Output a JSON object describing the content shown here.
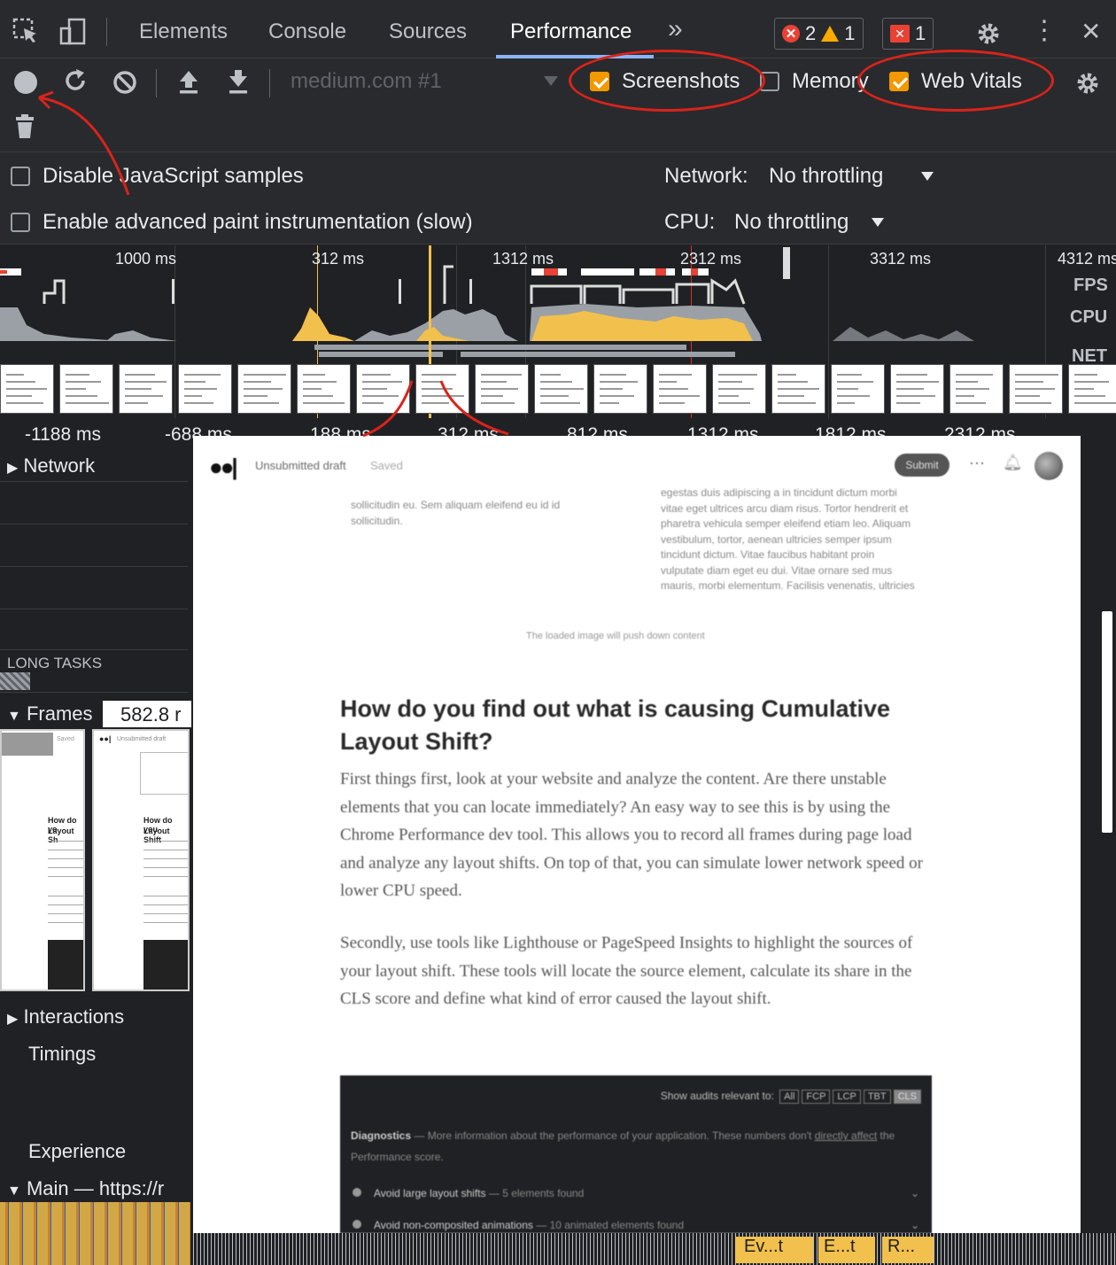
{
  "tabs": {
    "elements": "Elements",
    "console": "Console",
    "sources": "Sources",
    "performance": "Performance",
    "more": "»"
  },
  "badges": {
    "errors": "2",
    "warnings": "1",
    "issues": "1"
  },
  "toolbar": {
    "profile_select": "medium.com #1",
    "screenshots_label": "Screenshots",
    "memory_label": "Memory",
    "web_vitals_label": "Web Vitals",
    "screenshots_checked": true,
    "memory_checked": false,
    "web_vitals_checked": true
  },
  "settings": {
    "disable_js_samples": "Disable JavaScript samples",
    "advanced_paint": "Enable advanced paint instrumentation (slow)",
    "network_label": "Network:",
    "network_value": "No throttling",
    "cpu_label": "CPU:",
    "cpu_value": "No throttling"
  },
  "overview": {
    "ticks": [
      "1000 ms",
      "312 ms",
      "1312 ms",
      "2312 ms",
      "3312 ms",
      "4312 ms"
    ],
    "lanes": [
      "FPS",
      "CPU",
      "NET"
    ]
  },
  "ruler": {
    "ticks": [
      "-1188 ms",
      "-688 ms",
      "188 ms",
      "312 ms",
      "812 ms",
      "1312 ms",
      "1812 ms",
      "2312 ms"
    ]
  },
  "tracks": {
    "network": "Network",
    "long_tasks": "LONG TASKS",
    "frames": "Frames",
    "frames_time": "582.8 r",
    "interactions": "Interactions",
    "timings": "Timings",
    "experience": "Experience",
    "main": "Main — https://r"
  },
  "frame_thumbs": {
    "draft": "Unsubmitted draft",
    "saved": "Saved",
    "heading_1": "How do yo",
    "heading_1b": "Layout Sh",
    "heading_2": "How do you",
    "heading_2b": "Layout Shift"
  },
  "bottom_events": [
    "Ev...t",
    "E...t",
    "R..."
  ],
  "popup": {
    "draft": "Unsubmitted draft",
    "saved": "Saved",
    "submit": "Submit",
    "more": "···",
    "left_col": "sollicitudin eu. Sem aliquam eleifend eu id id sollicitudin.",
    "right_col": "egestas duis adipiscing a in tincidunt dictum morbi vitae eget ultrices arcu diam risus. Tortor hendrerit et pharetra vehicula semper eleifend etiam leo. Aliquam vestibulum, tortor, aenean ultricies semper ipsum tincidunt dictum. Vitae faucibus habitant proin vulputate diam eget eu dui. Vitae ornare sed mus mauris, morbi elementum. Facilisis venenatis, ultricies",
    "caption": "The loaded image will push down content",
    "heading": "How do you find out what is causing Cumulative Layout Shift?",
    "para1": "First things first, look at your website and analyze the content. Are there unstable elements that you can locate immediately? An easy way to see this is by using the Chrome Performance dev tool. This allows you to record all frames during page load and analyze any layout shifts. On top of that, you can simulate lower network speed or lower CPU speed.",
    "para2": "Secondly, use tools like Lighthouse or PageSpeed Insights to highlight the sources of your layout shift. These tools will locate the source element, calculate its share in the CLS score and define what kind of error caused the layout shift.",
    "lh_show": "Show audits relevant to:",
    "lh_chips": [
      "All",
      "FCP",
      "LCP",
      "TBT",
      "CLS"
    ],
    "lh_diag_title": "Diagnostics",
    "lh_diag_text": "— More information about the performance of your application. These numbers don't",
    "lh_diag_link": "directly affect",
    "lh_diag_text2": "the Performance score.",
    "lh_item1": "Avoid large layout shifts",
    "lh_item1_note": "— 5 elements found",
    "lh_item2": "Avoid non-composited animations",
    "lh_item2_note": "— 10 animated elements found"
  },
  "colors": {
    "annotation": "#d9231b",
    "scripting": "#f2c04c",
    "accent": "#f29900"
  }
}
